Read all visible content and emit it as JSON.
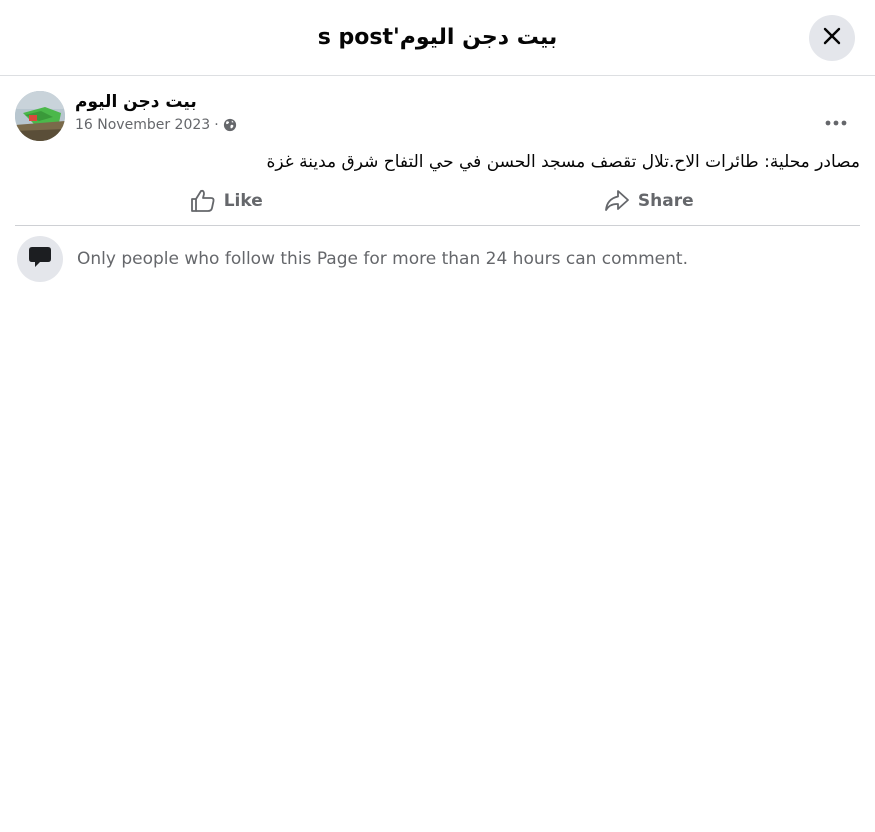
{
  "dialog": {
    "title": "بيت دجن اليوم's post",
    "close_icon": "close-icon"
  },
  "post": {
    "author": {
      "name": "بيت دجن اليوم",
      "avatar_icon": "page-avatar"
    },
    "date": "16 November 2023",
    "separator": "·",
    "audience_icon": "globe-icon",
    "more_icon": "more-options-icon",
    "text": "مصادر محلية: طائرات الاح.تلال تقصف مسجد الحسن في حي التفاح شرق مدينة غزة",
    "actions": {
      "like_label": "Like",
      "like_icon": "thumbs-up-icon",
      "share_label": "Share",
      "share_icon": "share-arrow-icon"
    }
  },
  "comments": {
    "notice": "Only people who follow this Page for more than 24 hours can comment.",
    "notice_icon": "comment-bubble-icon"
  }
}
